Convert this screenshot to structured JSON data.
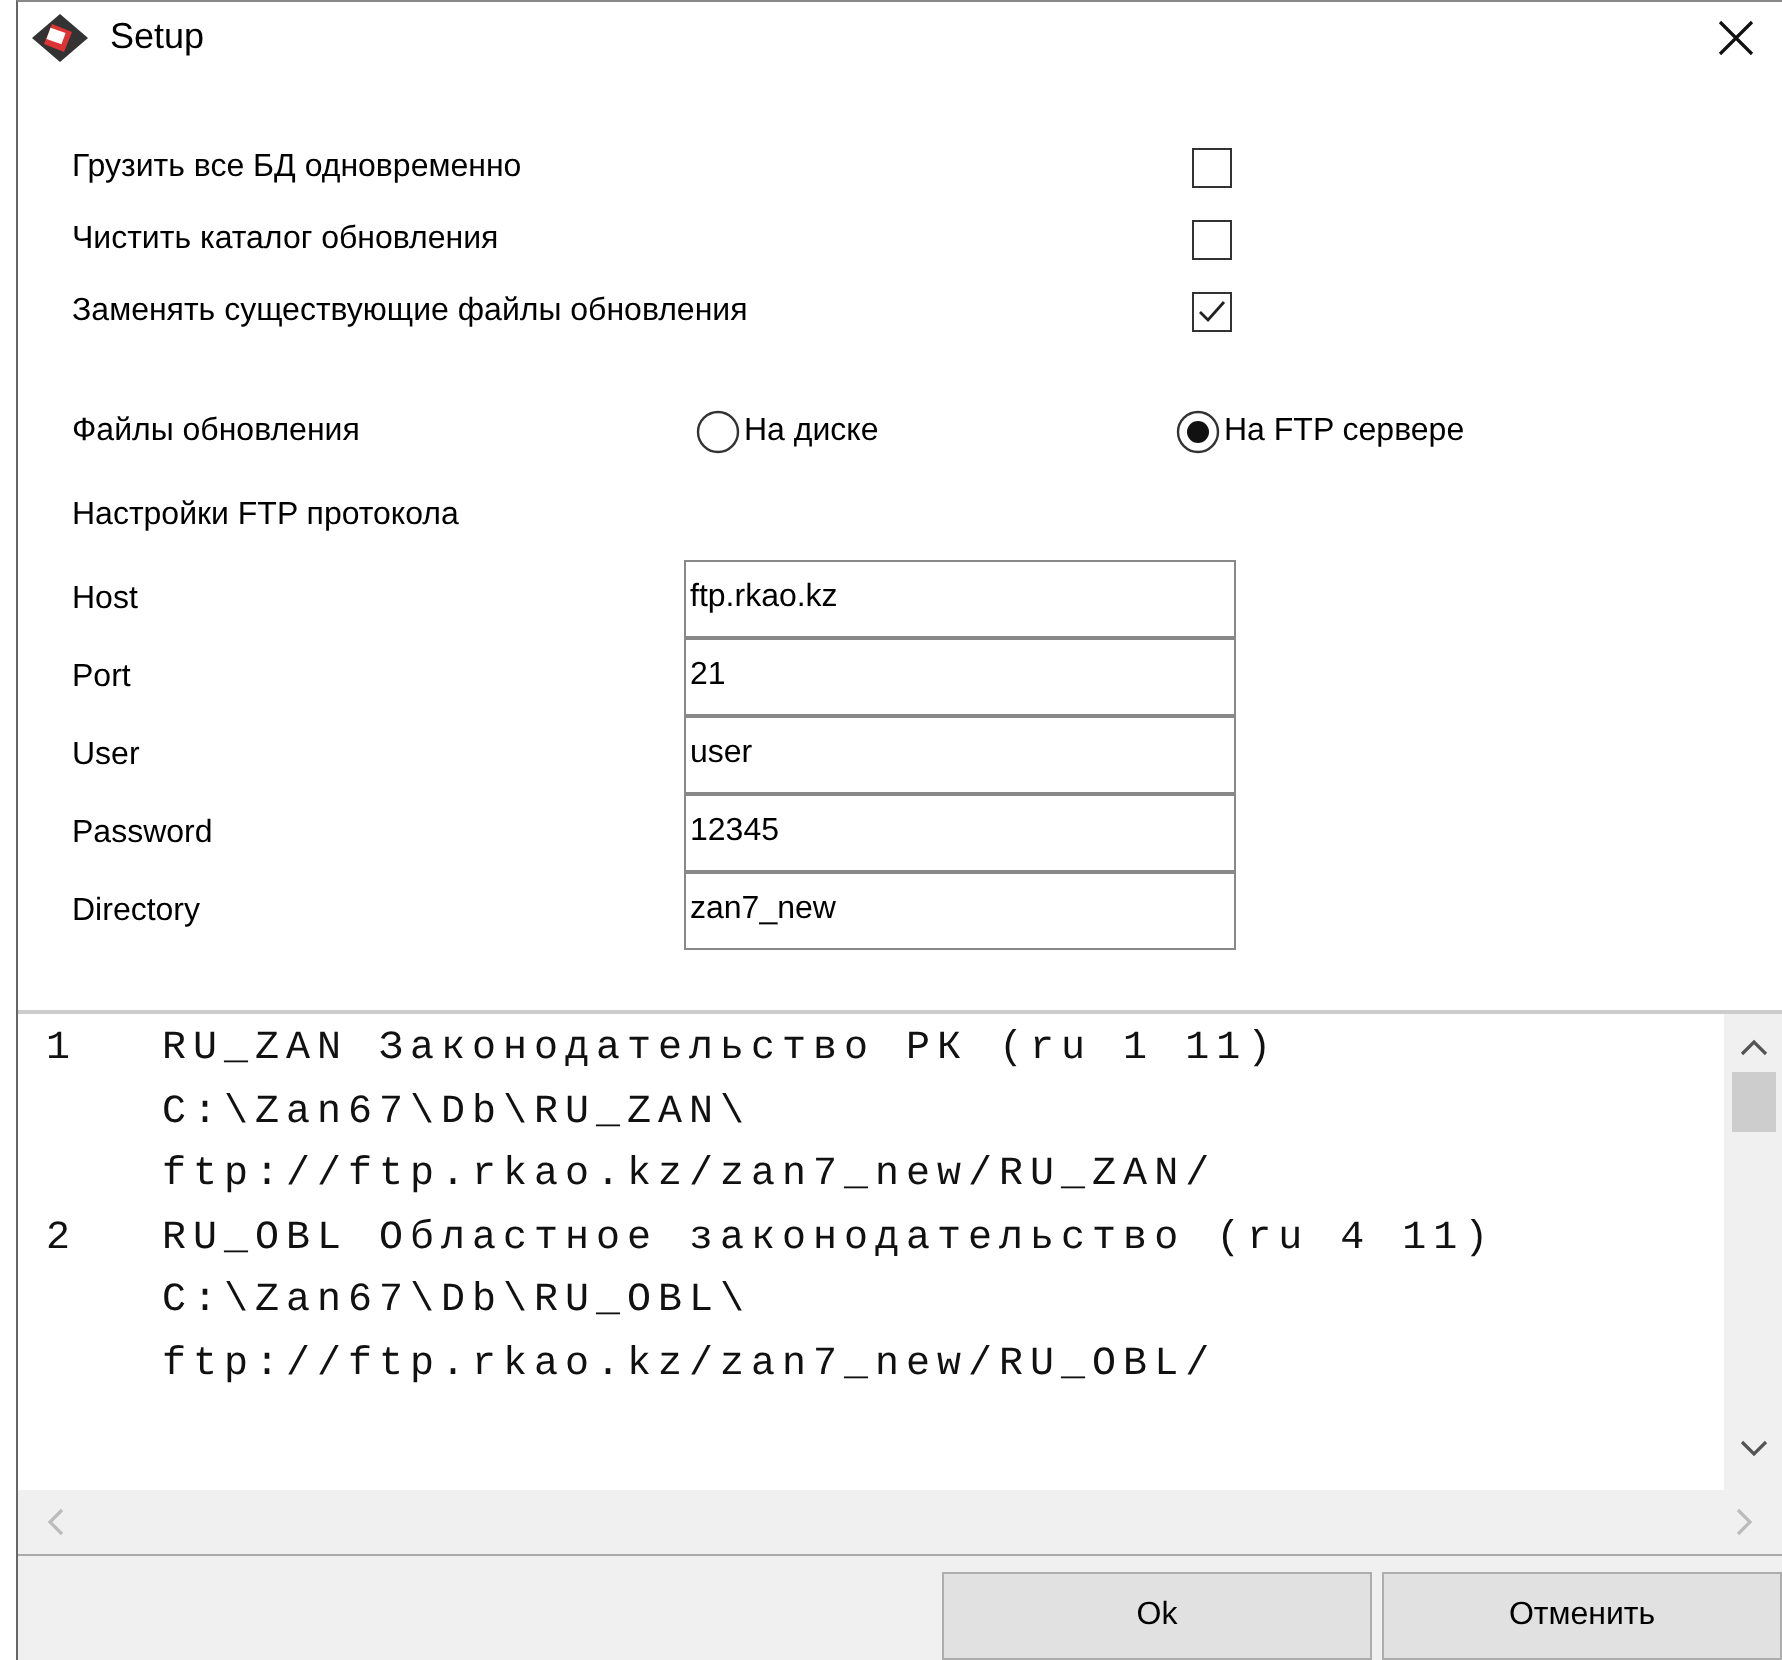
{
  "window": {
    "title": "Setup"
  },
  "options": [
    {
      "label": "Грузить все БД одновременно",
      "checked": false
    },
    {
      "label": "Чистить каталог обновления",
      "checked": false
    },
    {
      "label": "Заменять существующие файлы обновления",
      "checked": true
    }
  ],
  "update_source": {
    "label": "Файлы обновления",
    "choices": [
      {
        "label": "На диске",
        "selected": false
      },
      {
        "label": "На FTP сервере",
        "selected": true
      }
    ]
  },
  "ftp_section": {
    "title": "Настройки FTP протокола",
    "fields": [
      {
        "label": "Host",
        "value": "ftp.rkao.kz"
      },
      {
        "label": "Port",
        "value": "21"
      },
      {
        "label": "User",
        "value": "user"
      },
      {
        "label": "Password",
        "value": "12345"
      },
      {
        "label": "Directory",
        "value": "zan7_new"
      }
    ]
  },
  "listing": [
    {
      "number": "1",
      "lines": [
        "RU_ZAN Законодательство РК (ru 1 11)",
        "C:\\Zan67\\Db\\RU_ZAN\\",
        "ftp://ftp.rkao.kz/zan7_new/RU_ZAN/"
      ]
    },
    {
      "number": "2",
      "lines": [
        "RU_OBL Областное законодательство (ru 4 11)",
        "C:\\Zan67\\Db\\RU_OBL\\",
        "ftp://ftp.rkao.kz/zan7_new/RU_OBL/"
      ]
    }
  ],
  "buttons": [
    "Ok",
    "Отменить"
  ]
}
